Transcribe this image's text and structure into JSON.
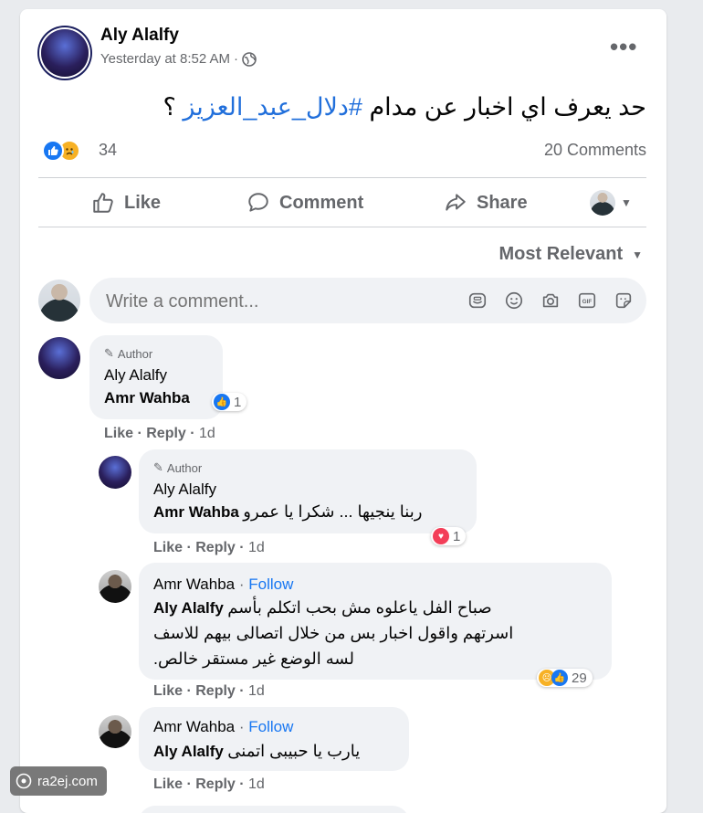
{
  "post": {
    "author": "Aly Alalfy",
    "timestamp": "Yesterday at 8:52 AM",
    "privacy_icon": "globe-icon",
    "text_plain": "حد يعرف اي اخبار عن مدام ",
    "hashtag": "#دلال_عبد_العزيز",
    "text_suffix": " ؟",
    "reaction_count": "34",
    "comments_count": "20 Comments",
    "reactions": [
      "like",
      "sad"
    ]
  },
  "actions": {
    "like": "Like",
    "comment": "Comment",
    "share": "Share"
  },
  "sort": {
    "label": "Most Relevant"
  },
  "composer": {
    "placeholder": "Write a comment...",
    "icons": [
      "sticker-icon",
      "emoji-icon",
      "camera-icon",
      "gif-icon",
      "sticker-face-icon"
    ]
  },
  "comments": [
    {
      "badge": "Author",
      "name": "Aly Alalfy",
      "mention": "Amr Wahba",
      "text": "",
      "like_label": "Like",
      "reply_label": "Reply",
      "time": "1d",
      "reaction_count": "1",
      "reaction": "like"
    },
    {
      "badge": "Author",
      "name": "Aly Alalfy",
      "mention": "Amr Wahba",
      "text": "ربنا ينجيها ... شكرا يا عمرو",
      "like_label": "Like",
      "reply_label": "Reply",
      "time": "1d",
      "reaction_count": "1",
      "reaction": "love"
    },
    {
      "name": "Amr Wahba",
      "follow": "Follow",
      "mention": "Aly Alalfy",
      "text_line1": "صباح الفل ياعلوه مش بحب اتكلم بأسم",
      "text_line2": "اسرتهم واقول اخبار بس من خلال اتصالى بيهم للاسف",
      "text_line3": "لسه الوضع غير مستقر خالص.",
      "like_label": "Like",
      "reply_label": "Reply",
      "time": "1d",
      "reaction_count": "29"
    },
    {
      "name": "Amr Wahba",
      "follow": "Follow",
      "mention": "Aly Alalfy",
      "text": "يارب يا حبيبى اتمنى",
      "like_label": "Like",
      "reply_label": "Reply",
      "time": "1d"
    }
  ],
  "watermark": "ra2ej.com",
  "colors": {
    "accent": "#1877f2",
    "hashtag": "#216fdb",
    "love": "#f33e58",
    "sad": "#f7b125"
  }
}
